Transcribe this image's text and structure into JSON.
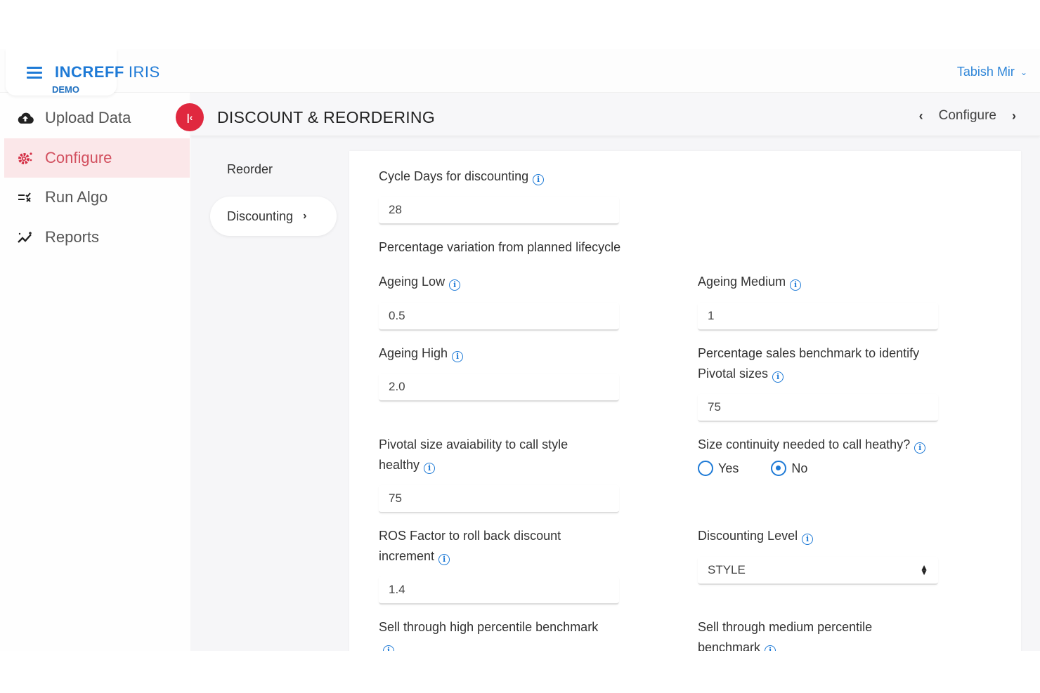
{
  "header": {
    "brand_bold": "INCREFF",
    "brand_light": "IRIS",
    "env_badge": "DEMO",
    "user_name": "Tabish Mir",
    "user_menu_icon": "chevron-down-icon"
  },
  "sidebar": {
    "items": [
      {
        "label": "Upload Data",
        "icon": "cloud-upload-icon",
        "active": false
      },
      {
        "label": "Configure",
        "icon": "gear-icon",
        "active": true
      },
      {
        "label": "Run Algo",
        "icon": "run-list-icon",
        "active": false
      },
      {
        "label": "Reports",
        "icon": "trend-chart-icon",
        "active": false
      }
    ],
    "collapse_icon": "collapse-left-icon"
  },
  "page": {
    "title": "DISCOUNT & REORDERING",
    "breadcrumb_current": "Configure",
    "prev_icon": "chevron-left-icon",
    "next_icon": "chevron-right-icon"
  },
  "subnav": {
    "items": [
      {
        "label": "Reorder",
        "active": false
      },
      {
        "label": "Discounting",
        "active": true
      }
    ]
  },
  "form": {
    "cycle_days": {
      "label": "Cycle Days for discounting",
      "value": "28"
    },
    "section_lifecycle": "Percentage variation from planned lifecycle",
    "ageing_low": {
      "label": "Ageing Low",
      "value": "0.5"
    },
    "ageing_medium": {
      "label": "Ageing Medium",
      "value": "1"
    },
    "ageing_high": {
      "label": "Ageing High",
      "value": "2.0"
    },
    "pivotal_sizes_benchmark": {
      "label_line1": "Percentage sales benchmark to identify",
      "label_line2": "Pivotal sizes",
      "value": "75"
    },
    "pivotal_size_availability": {
      "label_line1": "Pivotal size avaiability to call style",
      "label_line2": "healthy",
      "value": "75"
    },
    "size_continuity": {
      "label": "Size continuity needed to call heathy?",
      "options": [
        {
          "label": "Yes",
          "checked": false
        },
        {
          "label": "No",
          "checked": true
        }
      ]
    },
    "ros_factor": {
      "label_line1": "ROS Factor to roll back discount",
      "label_line2": "increment",
      "value": "1.4"
    },
    "discounting_level": {
      "label": "Discounting Level",
      "value": "STYLE"
    },
    "sell_through_high": {
      "label_line1": "Sell through high percentile benchmark"
    },
    "sell_through_medium": {
      "label_line1": "Sell through medium percentile",
      "label_line2": "benchmark"
    }
  },
  "colors": {
    "accent_blue": "#1e7ad6",
    "brand_red": "#e0283f",
    "active_nav_bg": "#fbe7e9",
    "active_nav_text": "#d2505f"
  }
}
